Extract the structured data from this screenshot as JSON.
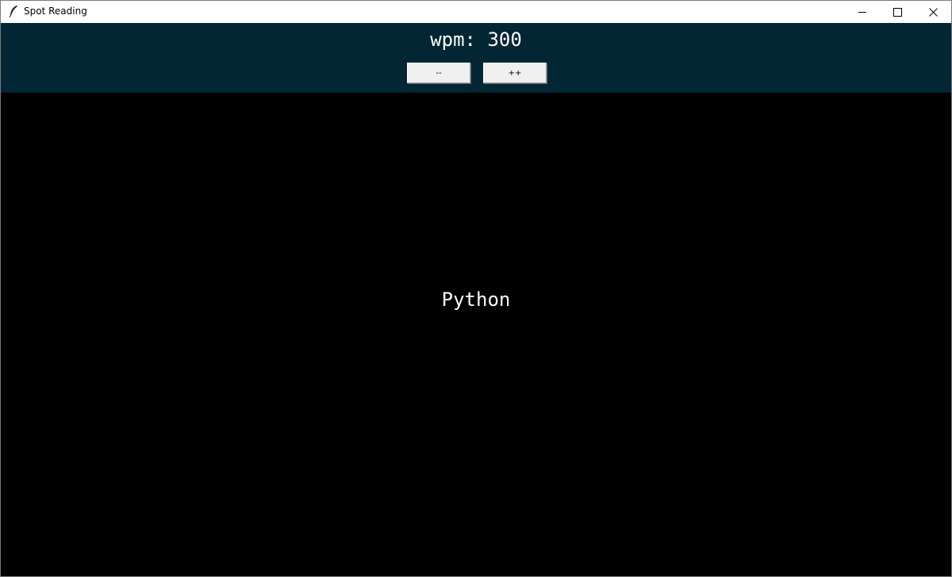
{
  "window": {
    "title": "Spot Reading",
    "app_icon": "feather-icon",
    "controls": {
      "minimize_icon": "minimize-icon",
      "maximize_icon": "maximize-icon",
      "close_icon": "close-icon"
    }
  },
  "toolbar": {
    "wpm_text": "wpm: 300",
    "decrease_label": "--",
    "increase_label": "++",
    "background": "#022634"
  },
  "reader": {
    "current_word": "Python",
    "background": "#000000",
    "text_color": "#ffffff"
  }
}
